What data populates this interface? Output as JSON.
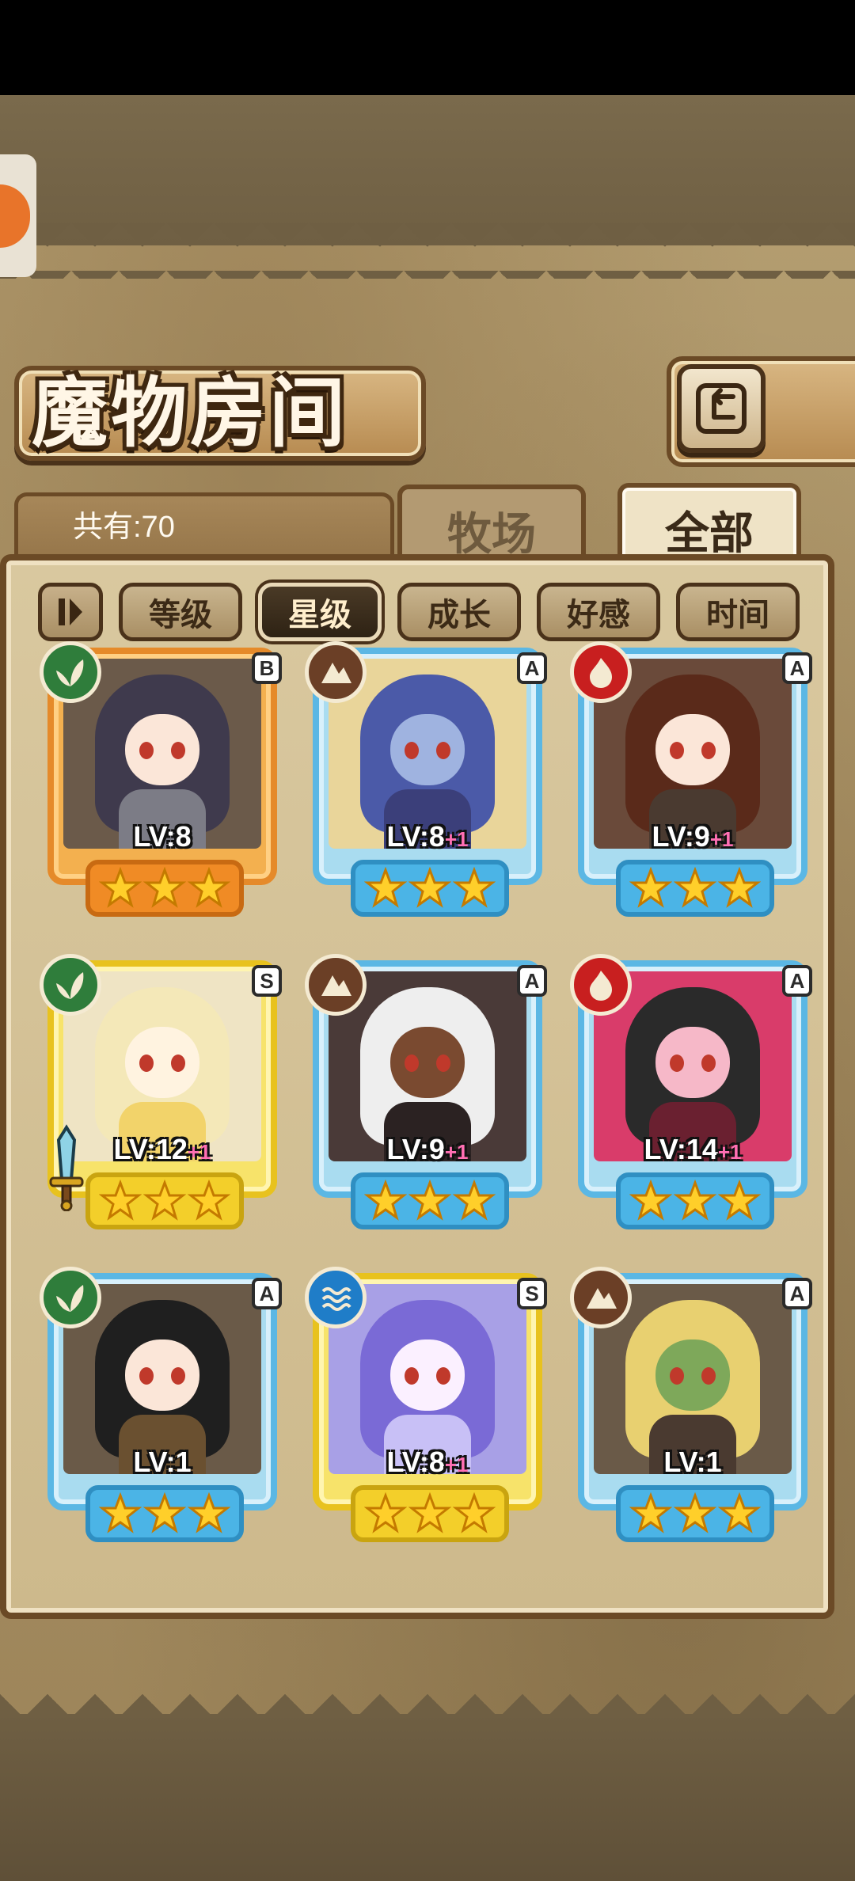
{
  "header": {
    "title": "魔物房间"
  },
  "summary": {
    "total_label": "共有:70"
  },
  "tabs": [
    {
      "label": "牧场",
      "active": false
    },
    {
      "label": "全部",
      "active": true
    }
  ],
  "sort_buttons": [
    {
      "label": "等级",
      "active": false
    },
    {
      "label": "星级",
      "active": true
    },
    {
      "label": "成长",
      "active": false
    },
    {
      "label": "好感",
      "active": false
    },
    {
      "label": "时间",
      "active": false
    }
  ],
  "monsters": [
    {
      "rank": "B",
      "element": "leaf-icon",
      "level": "LV:8",
      "bonus": "",
      "stars": 3
    },
    {
      "rank": "A",
      "element": "earth-icon",
      "level": "LV:8",
      "bonus": "+1",
      "stars": 3
    },
    {
      "rank": "A",
      "element": "fire-icon",
      "level": "LV:9",
      "bonus": "+1",
      "stars": 3
    },
    {
      "rank": "S",
      "element": "leaf-icon",
      "level": "LV:12",
      "bonus": "+1",
      "stars": 3,
      "equipped": "sword-icon"
    },
    {
      "rank": "A",
      "element": "earth-icon",
      "level": "LV:9",
      "bonus": "+1",
      "stars": 3
    },
    {
      "rank": "A",
      "element": "fire-icon",
      "level": "LV:14",
      "bonus": "+1",
      "stars": 3
    },
    {
      "rank": "A",
      "element": "leaf-icon",
      "level": "LV:1",
      "bonus": "",
      "stars": 3
    },
    {
      "rank": "S",
      "element": "water-icon",
      "level": "LV:8",
      "bonus": "+1",
      "stars": 3
    },
    {
      "rank": "A",
      "element": "earth-icon",
      "level": "LV:1",
      "bonus": "",
      "stars": 3
    }
  ],
  "colors": {
    "frame_b": "#e58a2a",
    "frame_a": "#5bb7e4",
    "frame_s": "#e8c21e",
    "plus_pink": "#ff6fb3"
  }
}
